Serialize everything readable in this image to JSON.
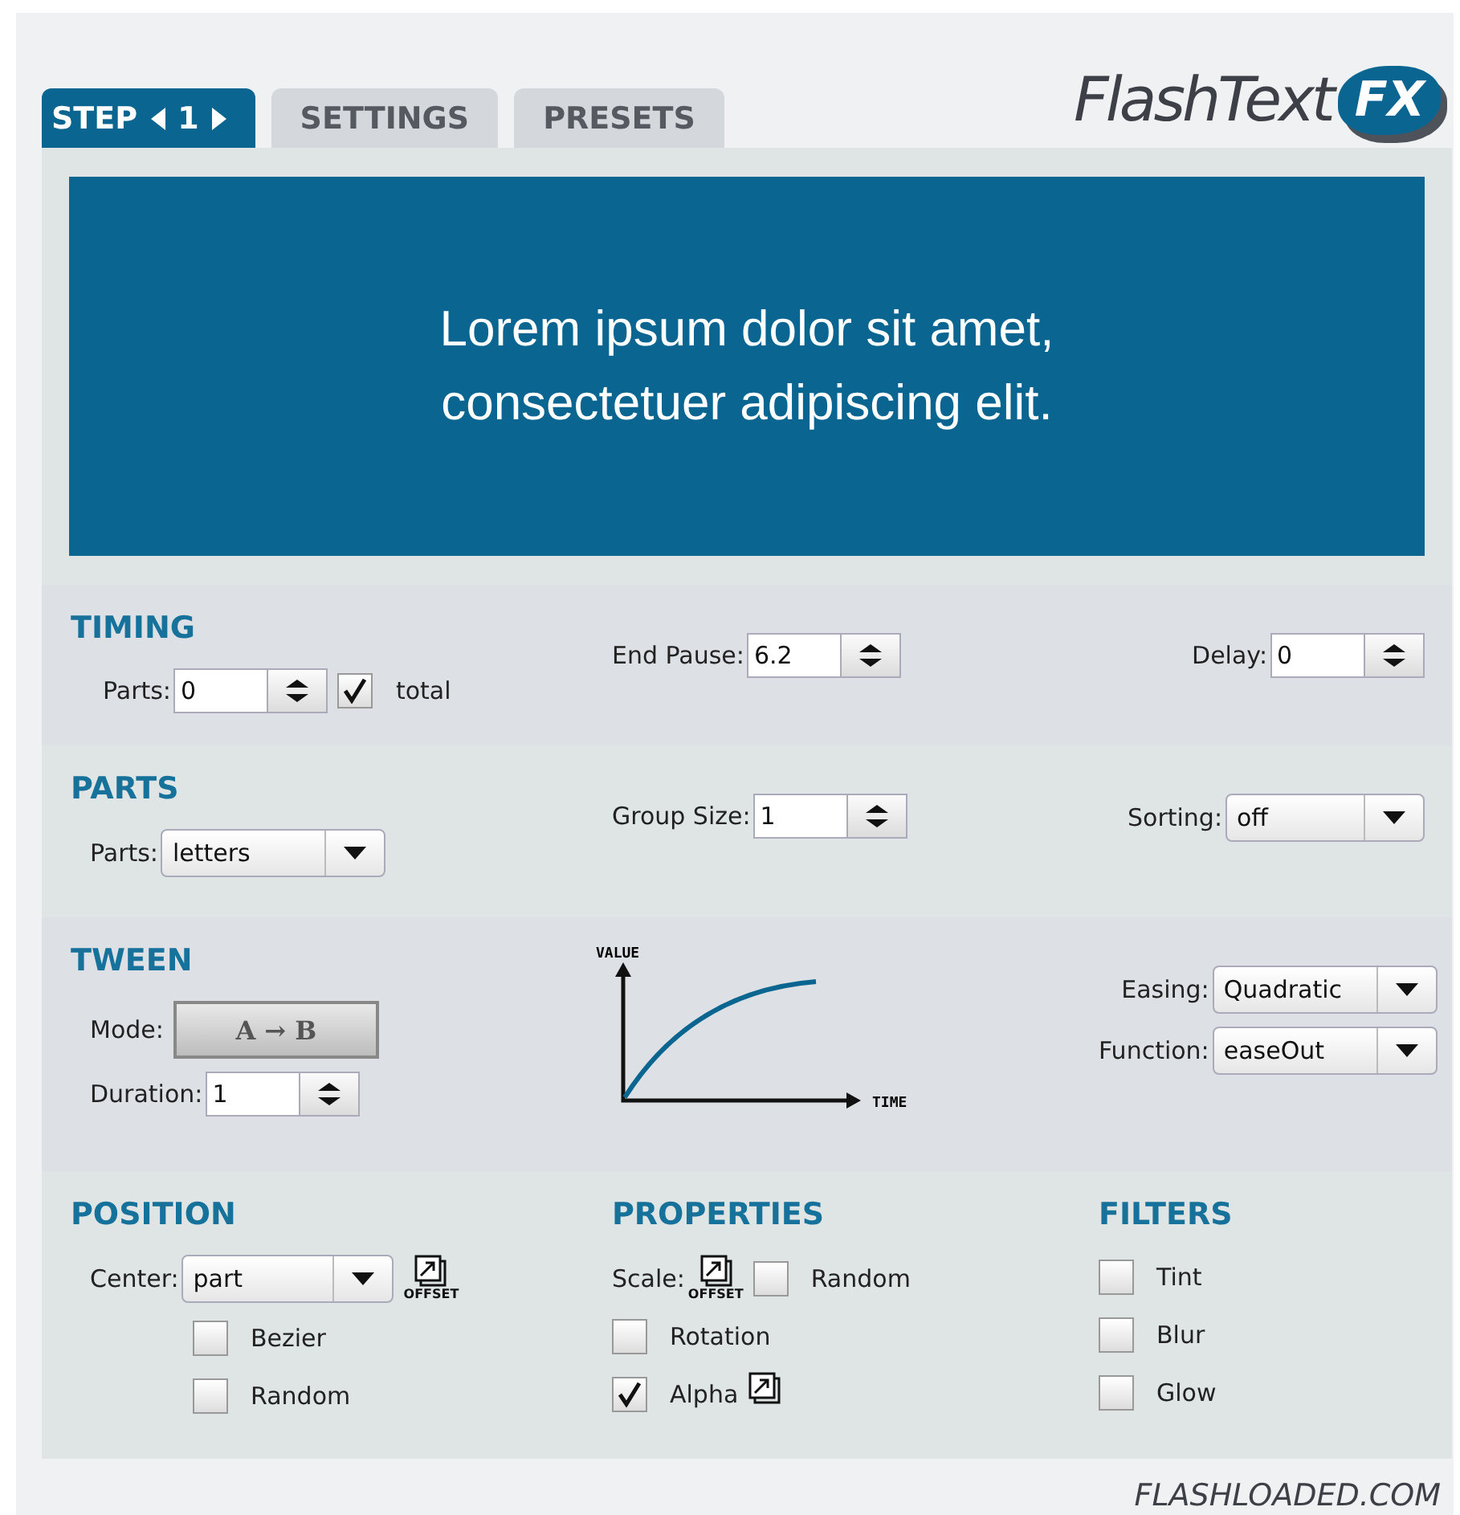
{
  "logo": {
    "text": "FlashText",
    "badge": "FX"
  },
  "tabs": [
    {
      "kind": "step",
      "label": "STEP",
      "number": "1",
      "selected": true
    },
    {
      "kind": "plain",
      "label": "SETTINGS",
      "selected": false
    },
    {
      "kind": "plain",
      "label": "PRESETS",
      "selected": false
    }
  ],
  "preview": {
    "lines": [
      "Lorem ipsum dolor sit amet,",
      "consectetuer adipiscing elit."
    ]
  },
  "sections": [
    {
      "kind": "timing",
      "title": "TIMING",
      "columns": [
        [
          [
            {
              "kind": "stepper",
              "label": "Parts:",
              "value": "0"
            },
            {
              "kind": "checkbox",
              "label": "total",
              "checked": true
            }
          ]
        ],
        [
          [
            {
              "kind": "stepper",
              "label": "End Pause:",
              "value": "6.2"
            }
          ]
        ],
        [
          [
            {
              "kind": "stepper",
              "label": "Delay:",
              "value": "0"
            }
          ]
        ]
      ]
    },
    {
      "kind": "parts",
      "title": "PARTS",
      "columns": [
        [
          [
            {
              "kind": "dropdown",
              "label": "Parts:",
              "value": "letters"
            }
          ]
        ],
        [
          [
            {
              "kind": "stepper",
              "label": "Group Size:",
              "value": "1"
            }
          ]
        ],
        [
          [
            {
              "kind": "dropdown",
              "label": "Sorting:",
              "value": "off"
            }
          ]
        ]
      ]
    },
    {
      "kind": "tween",
      "title": "TWEEN",
      "columns": [
        [
          [
            {
              "kind": "mode",
              "label": "Mode:",
              "value": "A → B"
            }
          ],
          [
            {
              "kind": "stepper",
              "label": "Duration:",
              "value": "1"
            }
          ]
        ],
        [
          [
            {
              "kind": "graph",
              "ylabel": "VALUE",
              "xlabel": "TIME"
            }
          ]
        ],
        [
          [
            {
              "kind": "dropdown",
              "label": "Easing:",
              "value": "Quadratic"
            }
          ],
          [
            {
              "kind": "dropdown",
              "label": "Function:",
              "value": "easeOut"
            }
          ]
        ]
      ]
    },
    {
      "kind": "position",
      "title": "POSITION",
      "columns": [
        [
          [
            {
              "kind": "dropdown",
              "label": "Center:",
              "value": "part"
            },
            {
              "kind": "offset",
              "caption": "OFFSET"
            }
          ],
          [
            {
              "kind": "checkbox",
              "label": "Bezier",
              "checked": false
            }
          ],
          [
            {
              "kind": "checkbox",
              "label": "Random",
              "checked": false
            }
          ]
        ],
        [
          [
            {
              "kind": "label",
              "label": "Scale:"
            },
            {
              "kind": "offset",
              "caption": "OFFSET"
            },
            {
              "kind": "checkbox",
              "label": "Random",
              "checked": false
            }
          ],
          [
            {
              "kind": "checkbox",
              "label": "Rotation",
              "checked": false
            }
          ],
          [
            {
              "kind": "checkbox",
              "label": "Alpha",
              "checked": true
            },
            {
              "kind": "offset"
            }
          ]
        ],
        [
          [
            {
              "kind": "checkbox",
              "label": "Tint",
              "checked": false
            }
          ],
          [
            {
              "kind": "checkbox",
              "label": "Blur",
              "checked": false
            }
          ],
          [
            {
              "kind": "checkbox",
              "label": "Glow",
              "checked": false
            }
          ]
        ]
      ],
      "titles": [
        "PROPERTIES",
        "FILTERS"
      ]
    }
  ],
  "footer": "FLASHLOADED.COM"
}
